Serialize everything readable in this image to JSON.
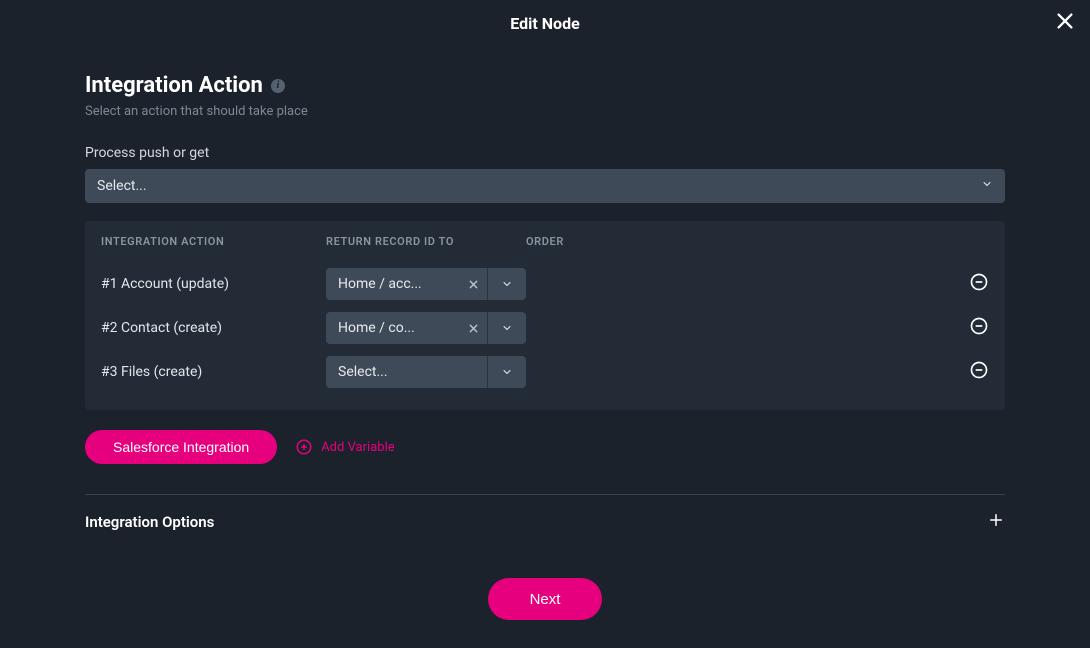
{
  "modal": {
    "title": "Edit Node"
  },
  "header": {
    "title": "Integration Action",
    "subtitle": "Select an action that should take place"
  },
  "processField": {
    "label": "Process push or get",
    "placeholder": "Select..."
  },
  "table": {
    "headers": {
      "action": "INTEGRATION ACTION",
      "return": "RETURN RECORD ID TO",
      "order": "ORDER"
    },
    "rows": [
      {
        "label": "#1 Account (update)",
        "return": "Home / acc...",
        "hasClear": true
      },
      {
        "label": "#2 Contact (create)",
        "return": "Home / co...",
        "hasClear": true
      },
      {
        "label": "#3 Files (create)",
        "return": "Select...",
        "hasClear": false
      }
    ]
  },
  "buttons": {
    "salesforce": "Salesforce Integration",
    "addVariable": "Add Variable",
    "next": "Next"
  },
  "options": {
    "title": "Integration Options"
  }
}
